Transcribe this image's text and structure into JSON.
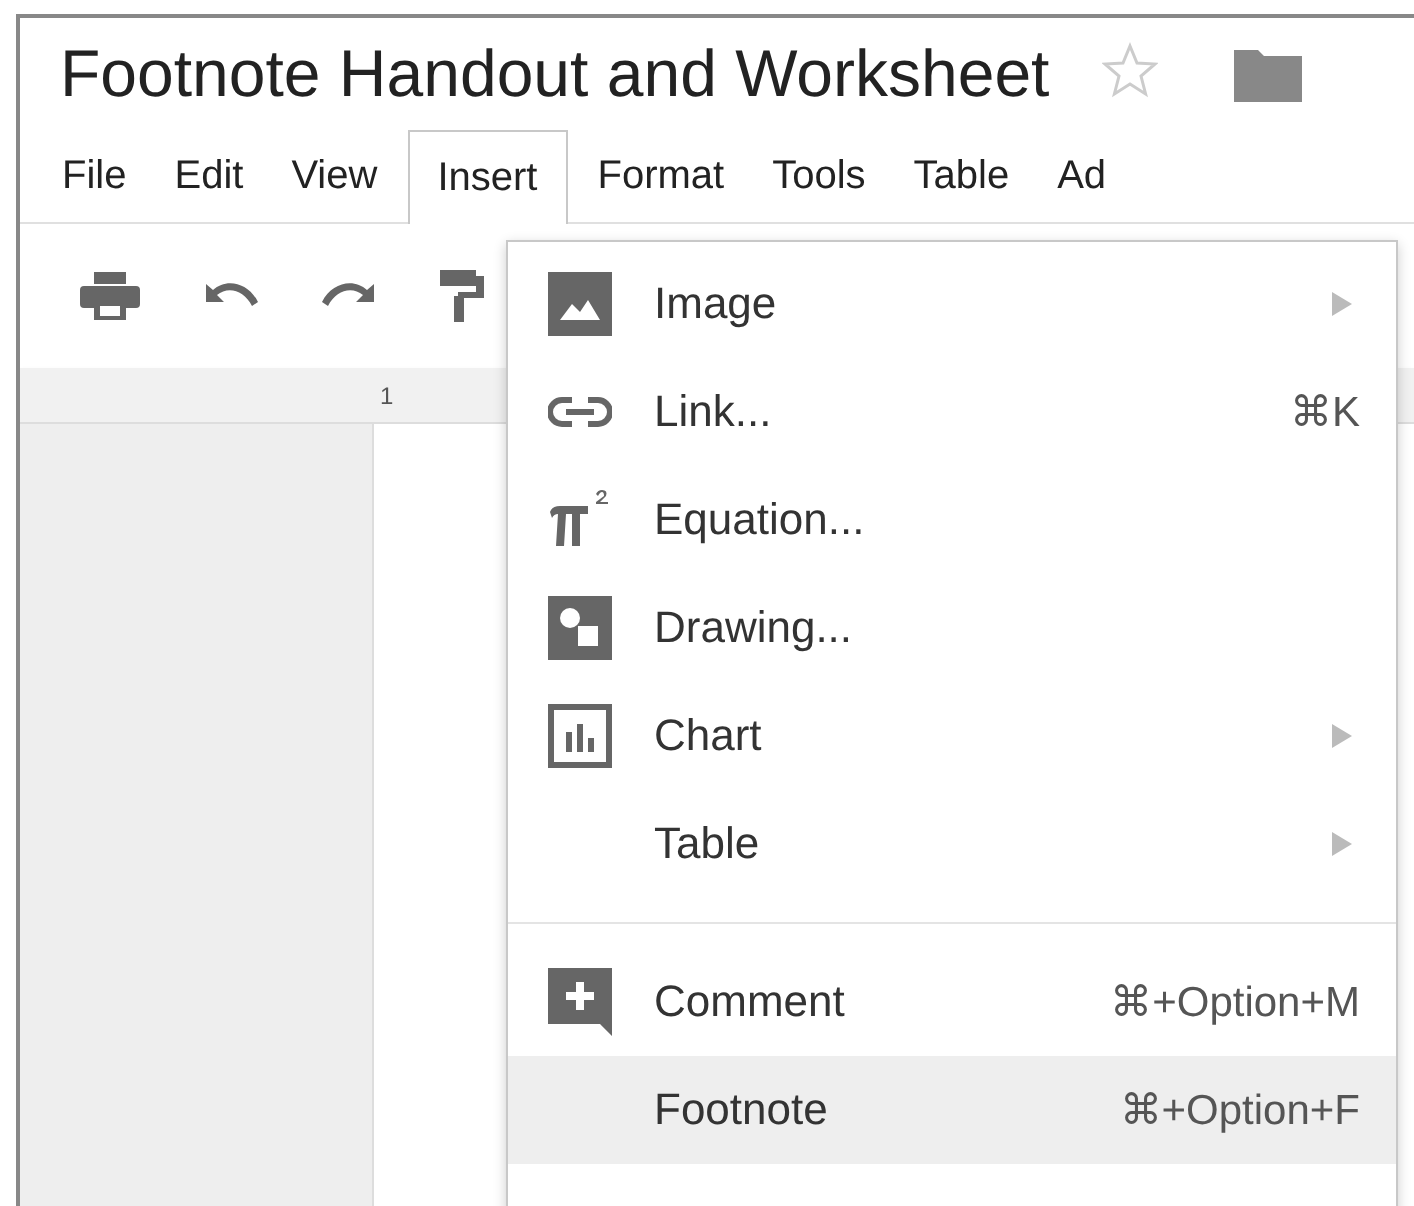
{
  "window": {
    "title": "Footnote Handout and Worksheet",
    "starred": false
  },
  "menubar": [
    {
      "label": "File",
      "selected": false
    },
    {
      "label": "Edit",
      "selected": false
    },
    {
      "label": "View",
      "selected": false
    },
    {
      "label": "Insert",
      "selected": true
    },
    {
      "label": "Format",
      "selected": false
    },
    {
      "label": "Tools",
      "selected": false
    },
    {
      "label": "Table",
      "selected": false
    },
    {
      "label": "Ad",
      "selected": false
    }
  ],
  "ruler": {
    "mark": "1"
  },
  "insert_menu": {
    "groups": [
      [
        {
          "label": "Image",
          "submenu": true,
          "selected": false
        },
        {
          "label": "Link...",
          "shortcut": "⌘K",
          "submenu": false,
          "selected": false
        },
        {
          "label": "Equation...",
          "submenu": false,
          "selected": false
        },
        {
          "label": "Drawing...",
          "submenu": false,
          "selected": false
        },
        {
          "label": "Chart",
          "submenu": true,
          "selected": false
        },
        {
          "label": "Table",
          "submenu": true,
          "selected": false
        }
      ],
      [
        {
          "label": "Comment",
          "shortcut": "⌘+Option+M",
          "submenu": false,
          "selected": false
        },
        {
          "label": "Footnote",
          "shortcut": "⌘+Option+F",
          "submenu": false,
          "selected": true
        }
      ]
    ]
  }
}
